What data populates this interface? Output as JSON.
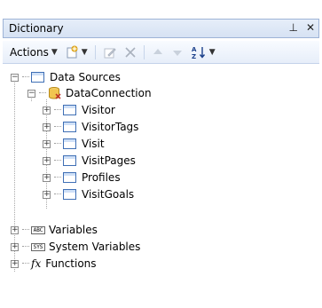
{
  "panel": {
    "title": "Dictionary",
    "pin_glyph": "⊥",
    "close_glyph": "✕"
  },
  "toolbar": {
    "actions_label": "Actions",
    "dropdown_caret": "▼",
    "new_item_icon": "new-item-icon",
    "edit_icon": "edit-icon",
    "delete_icon": "delete-icon",
    "move_up_icon": "move-up-icon",
    "move_down_icon": "move-down-icon",
    "sort_icon": "sort-az-icon"
  },
  "tree": {
    "data_sources": {
      "label": "Data Sources",
      "expander": "−"
    },
    "data_connection": {
      "label": "DataConnection",
      "expander": "−"
    },
    "tables": [
      {
        "label": "Visitor",
        "expander": "+"
      },
      {
        "label": "VisitorTags",
        "expander": "+"
      },
      {
        "label": "Visit",
        "expander": "+"
      },
      {
        "label": "VisitPages",
        "expander": "+"
      },
      {
        "label": "Profiles",
        "expander": "+"
      },
      {
        "label": "VisitGoals",
        "expander": "+"
      }
    ],
    "variables": {
      "label": "Variables",
      "expander": "+",
      "icon_text": "ABC"
    },
    "system_variables": {
      "label": "System Variables",
      "expander": "+",
      "icon_text": "SYS"
    },
    "functions": {
      "label": "Functions",
      "expander": "+",
      "icon_text": "fx"
    }
  }
}
